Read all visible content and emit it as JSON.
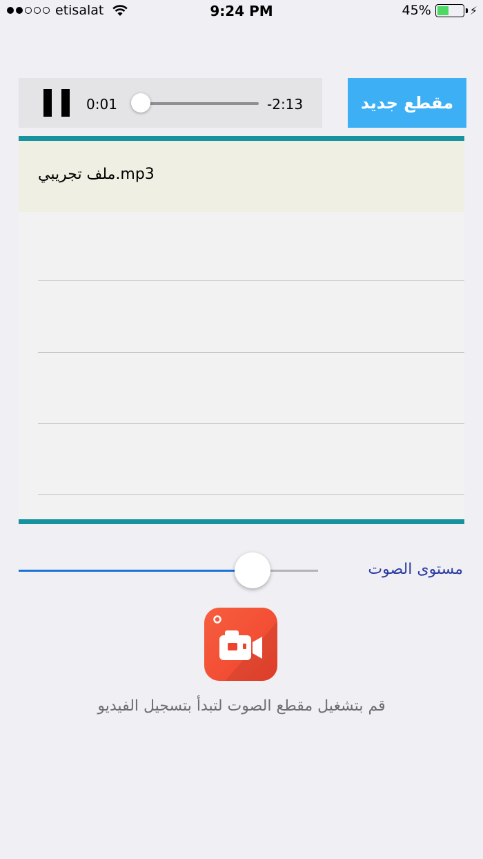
{
  "status_bar": {
    "carrier": "etisalat",
    "time": "9:24 PM",
    "battery_percent": "45%",
    "battery_level": 0.45,
    "signal_bars_filled": 2,
    "signal_bars_total": 5
  },
  "player": {
    "current_time": "0:01",
    "remaining_time": "-2:13",
    "progress": 0.01
  },
  "toolbar": {
    "new_clip_label": "مقطع جديد"
  },
  "audio_list": {
    "items": [
      {
        "label": "ملف تجريبي.mp3",
        "selected": true
      },
      {
        "label": ""
      },
      {
        "label": ""
      },
      {
        "label": ""
      },
      {
        "label": ""
      }
    ]
  },
  "volume": {
    "label": "مستوى الصوت",
    "level": 0.78
  },
  "hint": {
    "text": "قم بتشغيل مقطع الصوت لتبدأ بتسجيل الفيديو"
  },
  "colors": {
    "accent_button": "#3db0f5",
    "list_border": "#1793a0",
    "volume_track": "#1a73d9",
    "app_icon": "#f0432e"
  }
}
